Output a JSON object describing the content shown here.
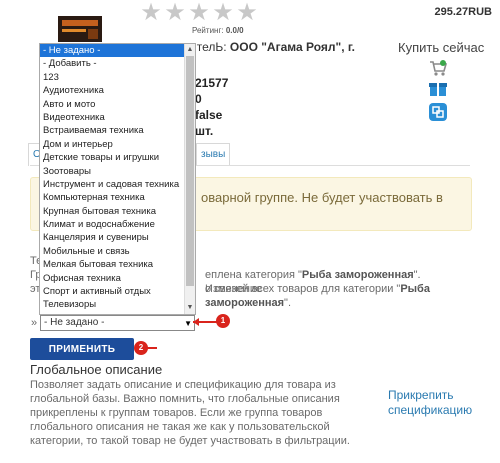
{
  "product": {
    "price": "295.27RUB",
    "rating_label": "Рейтинг:",
    "rating_value": "0.0/0",
    "seller_prefix": "ителЬ:",
    "seller_name": "ООО \"Агама Роял\", г.",
    "buy_label": "Купить сейчас",
    "info_line1": "21577",
    "info_line2": "0",
    "info_line3": "false",
    "info_line4": "шт."
  },
  "tabs": [
    {
      "label": "О"
    },
    {
      "label": "зывы"
    }
  ],
  "alert": {
    "text": "оварной группе. Не будет участвовать в"
  },
  "category_dropdown": {
    "options": [
      "- Не задано -",
      "- Добавить -",
      "123",
      "Аудиотехника",
      "Авто и мото",
      "Видеотехника",
      "Встраиваемая техника",
      "Дом и интерьер",
      "Детские товары и игрушки",
      "Зоотовары",
      "Инструмент и садовая техника",
      "Компьютерная техника",
      "Крупная бытовая техника",
      "Климат и водоснабжение",
      "Канцелярия и сувениры",
      "Мобильные и связь",
      "Мелкая бытовая техника",
      "Офисная техника",
      "Спорт и активный отдых",
      "Телевизоры"
    ],
    "selected_value": "- Не задано -"
  },
  "category_text": {
    "prefix_left": "Те",
    "line1_left": "Гр",
    "line1_mid": "еплена категория \"",
    "line1_bold": "Рыба замороженная",
    "line1_end": "\". Изменение",
    "line2_left": "эт",
    "line2_mid": "о связей всех товаров для категории \"",
    "line2_bold": "Рыба",
    "line3_bold": "замороженная",
    "line3_end": "\".",
    "marker": "»"
  },
  "apply_button": {
    "label": "ПРИМЕНИТЬ"
  },
  "annotations": {
    "badge1": "1",
    "badge2": "2"
  },
  "global_description": {
    "title": "Глобальное описание",
    "text": "Позволяет задать описание и спецификацию для товара из глобальной базы. Важно помнить, что глобальные описания прикреплены к группам товаров. Если же группа товаров глобального описания не такая же как у пользовательской категории, то такой товар не будет участвовать в фильтрации.",
    "attach_link": "Прикрепить спецификацию"
  },
  "colors": {
    "accent": "#1d4d9b",
    "link": "#2a7ab0",
    "annotation": "#d9241c",
    "selection": "#1e74d8"
  }
}
